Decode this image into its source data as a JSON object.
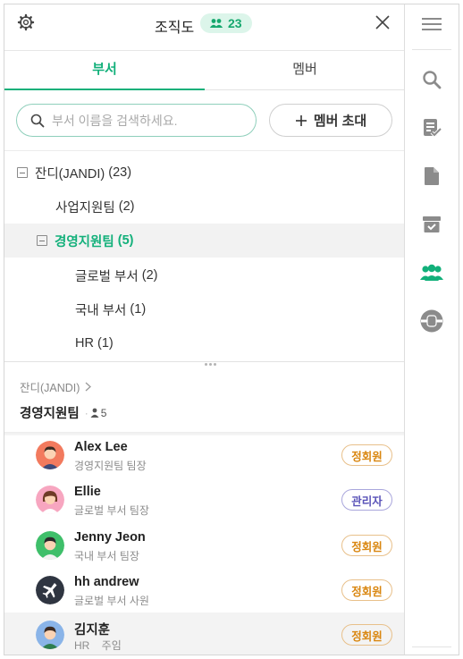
{
  "header": {
    "title": "조직도",
    "member_count": "23"
  },
  "tabs": [
    {
      "label": "부서",
      "active": true
    },
    {
      "label": "멤버",
      "active": false
    }
  ],
  "search": {
    "placeholder": "부서 이름을 검색하세요."
  },
  "invite_button": {
    "label": "멤버 초대"
  },
  "tree": [
    {
      "name": "잔디(JANDI)",
      "count": "(23)"
    },
    {
      "name": "사업지원팀",
      "count": "(2)"
    },
    {
      "name": "경영지원팀",
      "count": "(5)"
    },
    {
      "name": "글로벌 부서",
      "count": "(2)"
    },
    {
      "name": "국내 부서",
      "count": "(1)"
    },
    {
      "name": "HR",
      "count": "(1)"
    }
  ],
  "breadcrumb": {
    "parent": "잔디(JANDI)"
  },
  "department": {
    "name": "경영지원팀",
    "member_count": "5"
  },
  "members": [
    {
      "name": "Alex Lee",
      "role": "경영지원팀 팀장",
      "badge": "정회원"
    },
    {
      "name": "Ellie",
      "role": "글로벌 부서 팀장",
      "badge": "관리자"
    },
    {
      "name": "Jenny Jeon",
      "role": "국내 부서 팀장",
      "badge": "정회원"
    },
    {
      "name": "hh andrew",
      "role": "글로벌 부서 사원",
      "badge": "정회원"
    },
    {
      "name": "김지훈",
      "role": "HR    주임",
      "badge": "정회원"
    }
  ],
  "colors": {
    "accent": "#12b07a",
    "member_badge": "#d9860f",
    "admin_badge": "#5a53b8"
  },
  "rail_icons": [
    "menu-icon",
    "search-icon",
    "todo-icon",
    "file-icon",
    "archive-icon",
    "org-chart-icon",
    "integration-icon"
  ]
}
